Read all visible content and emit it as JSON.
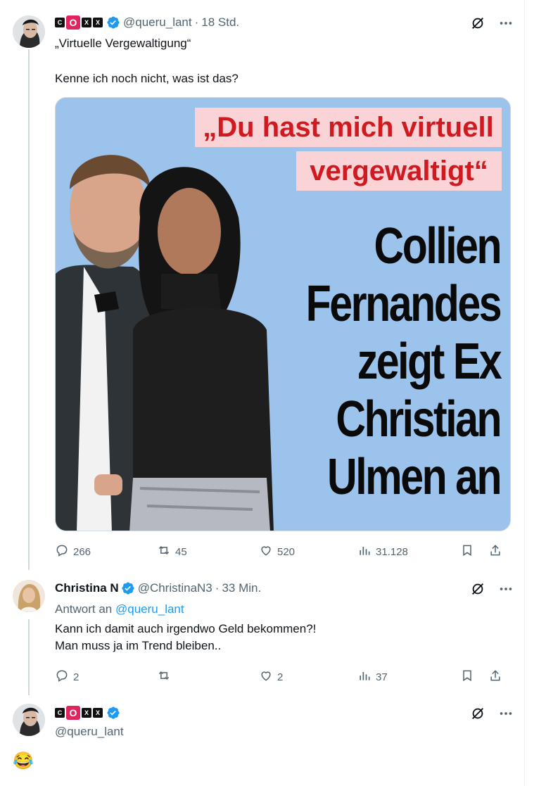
{
  "tweets": [
    {
      "author_badges": [
        "C",
        "O",
        "X",
        "X"
      ],
      "handle": "@queru_lant",
      "dot": "·",
      "time": "18 Std.",
      "lines": [
        "„Virtuelle Vergewaltigung“",
        "Kenne ich noch nicht, was ist das?"
      ],
      "media": {
        "quote_line1": "„Du hast mich virtuell",
        "quote_line2": "vergewaltigt“",
        "headline": [
          "Collien",
          "Fernandes",
          "zeigt Ex",
          "Christian",
          "Ulmen an"
        ]
      },
      "stats": {
        "replies": "266",
        "retweets": "45",
        "likes": "520",
        "views": "31.128"
      }
    },
    {
      "name": "Christina N",
      "handle": "@ChristinaN3",
      "dot": "·",
      "time": "33 Min.",
      "reply_prefix": "Antwort an",
      "reply_to": "@queru_lant",
      "lines": [
        "Kann ich damit auch irgendwo Geld bekommen?!",
        "Man muss ja im Trend bleiben.."
      ],
      "stats": {
        "replies": "2",
        "retweets": "",
        "likes": "2",
        "views": "37"
      }
    },
    {
      "author_badges": [
        "C",
        "O",
        "X",
        "X"
      ],
      "handle": "@queru_lant",
      "emoji": "😂"
    }
  ],
  "icons": [
    "grok-icon",
    "more-icon",
    "reply-icon",
    "retweet-icon",
    "like-icon",
    "views-icon",
    "bookmark-icon",
    "share-icon",
    "verified-icon"
  ],
  "colors": {
    "accent": "#1d9bf0",
    "muted": "#536471",
    "headline_red": "#d01a20",
    "media_bg": "#9cc3ec"
  }
}
